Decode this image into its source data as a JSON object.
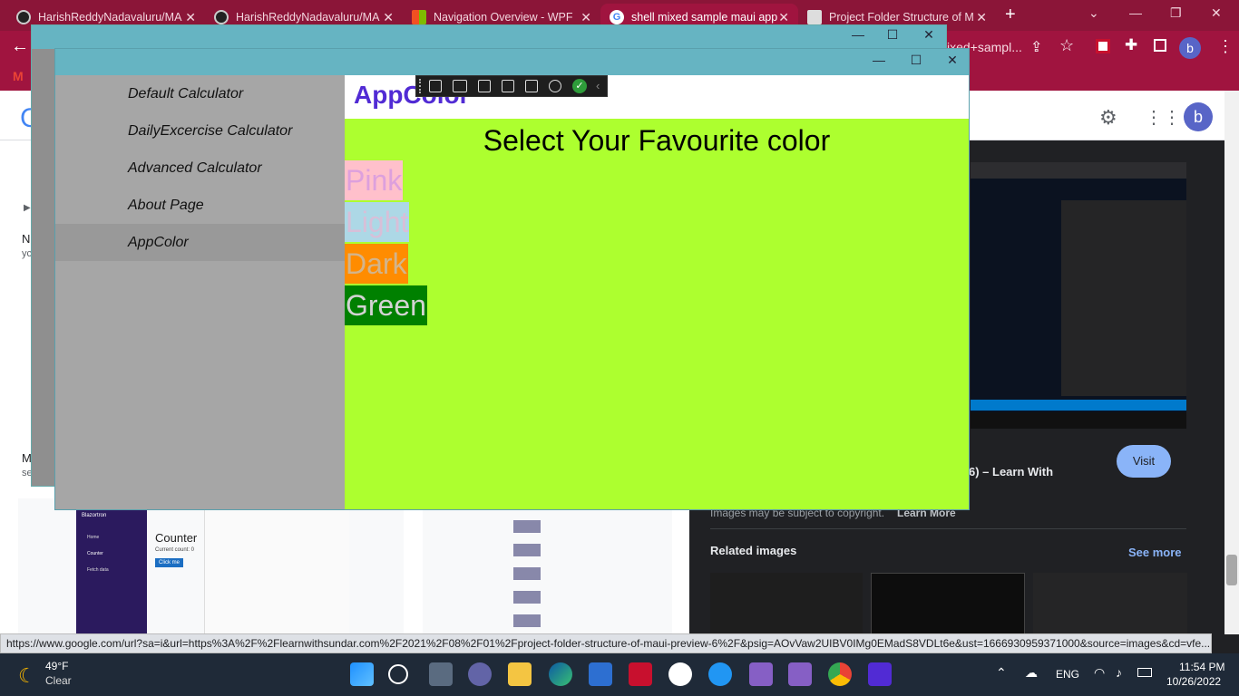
{
  "browser": {
    "tabs": [
      {
        "label": "HarishReddyNadavaluru/MA"
      },
      {
        "label": "HarishReddyNadavaluru/MA"
      },
      {
        "label": "Navigation Overview - WPF"
      },
      {
        "label": "shell mixed sample maui app"
      },
      {
        "label": "Project Folder Structure of M"
      }
    ],
    "new_tab": "+",
    "omnibox_text": "ixed+sampl...",
    "profile_initial": "b",
    "status_url": "https://www.google.com/url?sa=i&url=https%3A%2F%2Flearnwithsundar.com%2F2021%2F08%2F01%2Fproject-folder-structure-of-maui-preview-6%2F&psig=AOvVaw2UIBV0IMg0EMadS8VDLt6e&ust=1666930959371000&source=images&cd=vfe..."
  },
  "google": {
    "result_title_fragment": "6) – Learn With",
    "visit_label": "Visit",
    "copyright_note": "Images may be subject to copyright.",
    "learn_more": "Learn More",
    "related_images": "Related images",
    "see_more": "See more",
    "left_fragment_1": "N",
    "left_fragment_1b": "yc",
    "left_fragment_2": "M",
    "left_fragment_2b": "se",
    "counter_heading": "Counter",
    "counter_sub": "Current count: 0",
    "counter_btn": "Click me",
    "blazor_brand": "Blazortron",
    "blazor_nav": [
      "Home",
      "Counter",
      "Fetch data"
    ]
  },
  "app": {
    "flyout_items": [
      {
        "label": "Default Calculator"
      },
      {
        "label": "DailyExcercise Calculator"
      },
      {
        "label": "Advanced Calculator"
      },
      {
        "label": "About Page"
      },
      {
        "label": "AppColor"
      }
    ],
    "page_title": "AppColor",
    "heading": "Select Your Favourite color",
    "color_buttons": [
      {
        "label": "Pink",
        "bg": "#ffc0cb",
        "fg": "#dda0dd"
      },
      {
        "label": "Light",
        "bg": "#add8e6",
        "fg": "#d8bfd8"
      },
      {
        "label": "Dark",
        "bg": "#ff8c00",
        "fg": "#d2b48c"
      },
      {
        "label": "Green",
        "bg": "#008000",
        "fg": "#d3d3d3"
      }
    ],
    "window_controls": {
      "minimize": "—",
      "maximize": "☐",
      "close": "✕"
    }
  },
  "taskbar": {
    "weather_temp": "49°F",
    "weather_desc": "Clear",
    "language": "ENG",
    "time": "11:54 PM",
    "date": "10/26/2022"
  },
  "colors": {
    "browser_frame": "#a0143f",
    "app_accent": "#512bd4",
    "content_bg": "#adff2f",
    "titlebar": "#66b4c2"
  }
}
